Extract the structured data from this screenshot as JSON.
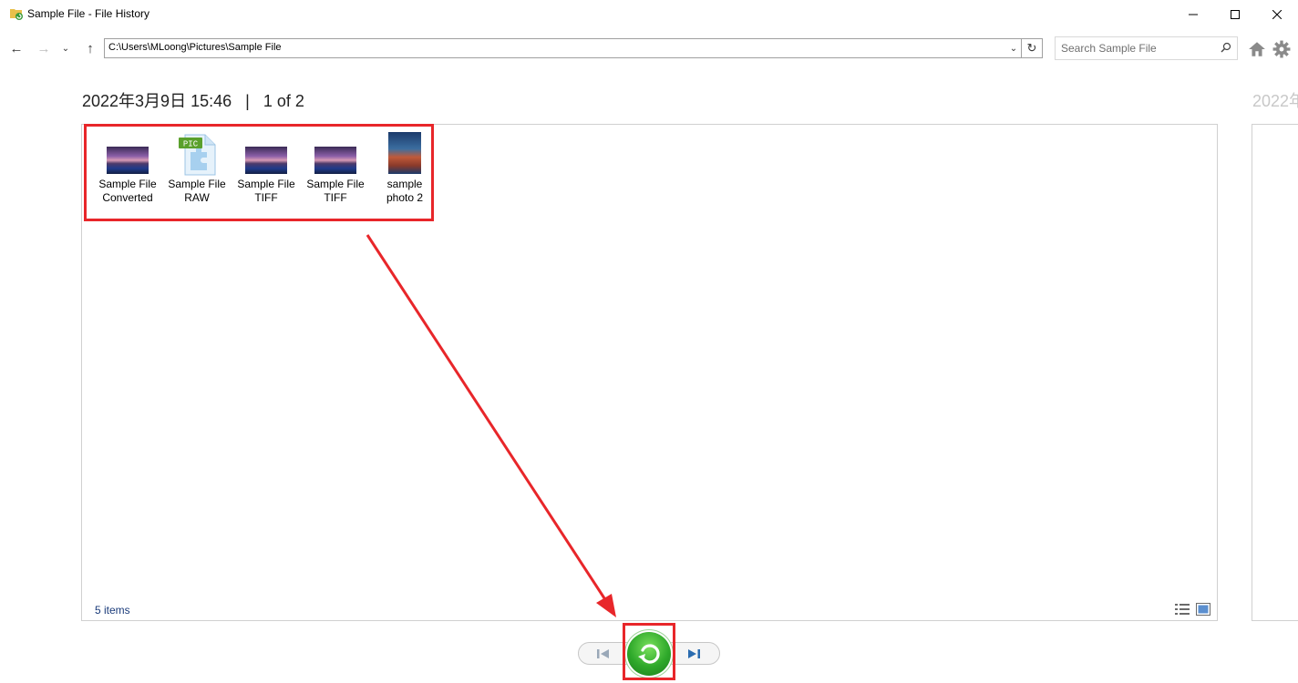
{
  "window": {
    "title": "Sample File - File History",
    "minimize_icon": "minimize-icon",
    "maximize_icon": "maximize-icon",
    "close_icon": "close-icon"
  },
  "nav": {
    "back_icon": "back-arrow-icon",
    "forward_icon": "forward-arrow-icon",
    "recent_icon": "chevron-down-icon",
    "up_icon": "up-arrow-icon",
    "address": "C:\\Users\\MLoong\\Pictures\\Sample File",
    "search_placeholder": "Search Sample File",
    "home_icon": "home-icon",
    "settings_icon": "gear-icon"
  },
  "header": {
    "date": "2022年3月9日 15:46",
    "separator": "|",
    "position": "1 of 2",
    "next_date": "2022年"
  },
  "files": [
    {
      "label_line1": "Sample File",
      "label_line2": "Converted",
      "icon": "image-thumbnail"
    },
    {
      "label_line1": "Sample File",
      "label_line2": "RAW",
      "icon": "pic-file-icon",
      "badge": "PIC"
    },
    {
      "label_line1": "Sample File",
      "label_line2": "TIFF",
      "icon": "image-thumbnail"
    },
    {
      "label_line1": "Sample File",
      "label_line2": "TIFF",
      "icon": "image-thumbnail"
    },
    {
      "label_line1": "sample",
      "label_line2": "photo 2",
      "icon": "photo-thumbnail"
    }
  ],
  "status": {
    "item_count": "5 items"
  },
  "controls": {
    "previous_icon": "previous-version-icon",
    "restore_icon": "restore-icon",
    "next_icon": "next-version-icon"
  },
  "colors": {
    "annotation": "#e8262a",
    "restore_green": "#2ea82a",
    "nav_blue": "#2b6cb0",
    "status_text": "#1a3b7a"
  }
}
